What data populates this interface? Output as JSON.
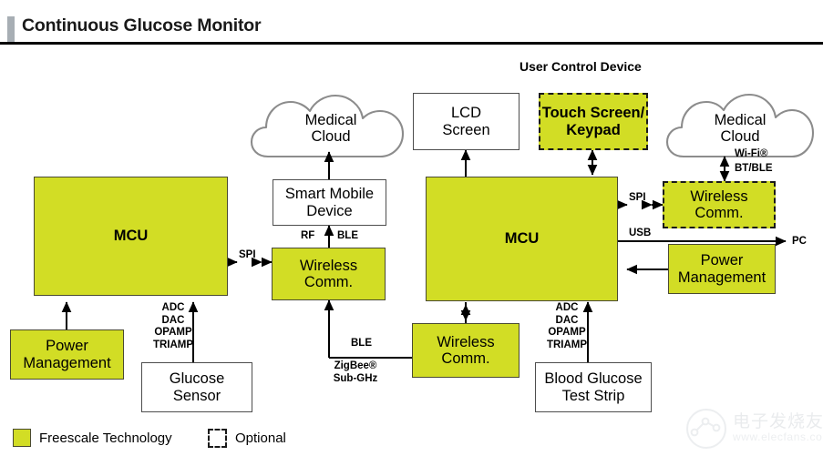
{
  "header": {
    "title": "Continuous Glucose Monitor",
    "accent_color": "#a7aeb4",
    "rule_color": "#000000"
  },
  "theme": {
    "freescale_green": "#d2dd25",
    "box_border": "#4d4d4d",
    "cloud_stroke": "#8c8c8c"
  },
  "sections": {
    "user_control_device": "User Control Device"
  },
  "blocks": {
    "mcu_left": "MCU",
    "power_management_left": "Power\nManagement",
    "glucose_sensor": "Glucose\nSensor",
    "medical_cloud_left": "Medical\nCloud",
    "smart_mobile_device": "Smart Mobile\nDevice",
    "wireless_comm_left": "Wireless\nComm.",
    "lcd_screen": "LCD\nScreen",
    "wireless_comm_center": "Wireless\nComm.",
    "touch_screen_keypad": "Touch Screen/\nKeypad",
    "mcu_right": "MCU",
    "medical_cloud_right": "Medical\nCloud",
    "wireless_comm_right": "Wireless\nComm.",
    "power_management_right": "Power\nManagement",
    "blood_glucose_test_strip": "Blood Glucose\nTest Strip"
  },
  "block_lines": {
    "mcu_left": [
      "MCU"
    ],
    "power_management_left": [
      "Power",
      "Management"
    ],
    "glucose_sensor": [
      "Glucose",
      "Sensor"
    ],
    "medical_cloud_left": [
      "Medical",
      "Cloud"
    ],
    "smart_mobile_device": [
      "Smart Mobile",
      "Device"
    ],
    "wireless_comm_left": [
      "Wireless",
      "Comm."
    ],
    "lcd_screen": [
      "LCD",
      "Screen"
    ],
    "wireless_comm_center": [
      "Wireless",
      "Comm."
    ],
    "touch_screen_keypad": [
      "Touch Screen/",
      "Keypad"
    ],
    "mcu_right": [
      "MCU"
    ],
    "medical_cloud_right": [
      "Medical",
      "Cloud"
    ],
    "wireless_comm_right": [
      "Wireless",
      "Comm."
    ],
    "power_management_right": [
      "Power",
      "Management"
    ],
    "blood_glucose_test_strip": [
      "Blood Glucose",
      "Test Strip"
    ]
  },
  "connection_labels": {
    "spi_left": "SPI",
    "rf": "RF",
    "ble_upper": "BLE",
    "analog_left_l1": "ADC",
    "analog_left_l2": "DAC",
    "analog_left_l3": "OPAMP",
    "analog_left_l4": "TRIAMP",
    "ble_center": "BLE",
    "zigbee": "ZigBee®",
    "sub_ghz": "Sub-GHz",
    "spi_right": "SPI",
    "usb": "USB",
    "pc": "PC",
    "wifi": "Wi-Fi®",
    "bt_ble": "BT/BLE",
    "analog_right_l1": "ADC",
    "analog_right_l2": "DAC",
    "analog_right_l3": "OPAMP",
    "analog_right_l4": "TRIAMP"
  },
  "legend": {
    "freescale": "Freescale Technology",
    "optional": "Optional"
  },
  "watermark": {
    "chinese": "电子发烧友",
    "url": "www.elecfans.com"
  }
}
